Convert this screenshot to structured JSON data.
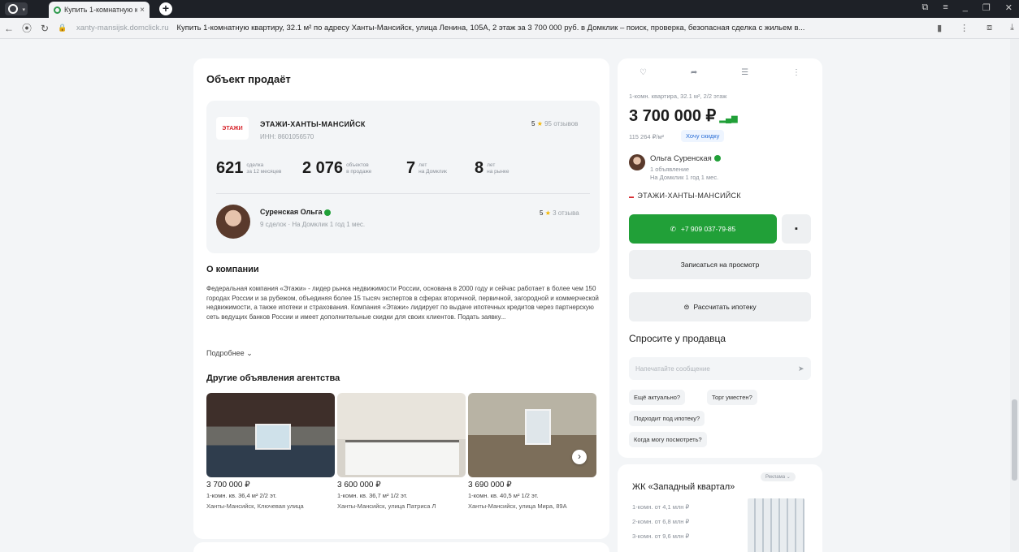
{
  "browser": {
    "tab_title": "Купить 1-комнатную к",
    "url_host": "xanty-mansijsk.domclick.ru",
    "page_title": "Купить 1-комнатную квартиру, 32.1 м² по адресу Ханты-Мансийск, улица Ленина, 105А, 2 этаж за 3 700 000 руб. в Домклик – поиск, проверка, безопасная сделка с жильем в..."
  },
  "seller_section": {
    "title": "Объект продаёт",
    "agency": {
      "logo_text": "ЭТАЖИ",
      "name": "ЭТАЖИ-ХАНТЫ-МАНСИЙСК",
      "inn": "ИНН: 8601056570",
      "rating": "5",
      "reviews": "95 отзывов"
    },
    "stats": [
      {
        "value": "621",
        "label1": "сделка",
        "label2": "за 12 месяцев"
      },
      {
        "value": "2 076",
        "label1": "объектов",
        "label2": "в продаже"
      },
      {
        "value": "7",
        "label1": "лет",
        "label2": "на Домклик"
      },
      {
        "value": "8",
        "label1": "лет",
        "label2": "на рынке"
      }
    ],
    "agent": {
      "name": "Суренская Ольга",
      "meta": "9 сделок · На Домклик 1 год 1 мес.",
      "rating": "5",
      "reviews": "3 отзыва"
    }
  },
  "about": {
    "title": "О компании",
    "text": "Федеральная компания «Этажи» - лидер рынка недвижимости России, основана в 2000 году и сейчас работает в более чем 150 городах России и за рубежом, объединяя более 15 тысяч экспертов в сферах вторичной, первичной, загородной и коммерческой недвижимости, а также ипотеки и страхования. Компания «Этажи» лидирует по выдаче ипотечных кредитов через партнерскую сеть ведущих банков России и имеет дополнительные скидки для своих клиентов. Подать заявку...",
    "more_label": "Подробнее"
  },
  "other_listings": {
    "title": "Другие объявления агентства",
    "items": [
      {
        "price": "3 700 000 ₽",
        "params": "1-комн. кв.  36,4 м²  2/2 эт.",
        "address": "Ханты-Мансийск, Ключевая улица"
      },
      {
        "price": "3 600 000 ₽",
        "params": "1-комн. кв.  36,7 м²  1/2 эт.",
        "address": "Ханты-Мансийск, улица Патриса Л"
      },
      {
        "price": "3 690 000 ₽",
        "params": "1-комн. кв.  40,5 м²  1/2 эт.",
        "address": "Ханты-Мансийск, улица Мира, 89А"
      }
    ]
  },
  "offer": {
    "subtitle": "1-комн. квартира, 32.1 м², 2/2 этаж",
    "price": "3 700 000 ₽",
    "price_per_m": "115 264 ₽/м²",
    "discount_label": "Хочу скидку",
    "agent_name": "Ольга Суренская",
    "agent_listings": "1 объявление",
    "agent_since": "На Домклик 1 год 1 мес.",
    "agency_name": "ЭТАЖИ-ХАНТЫ-МАНСИЙСК",
    "phone": "+7 909 037-79-85",
    "viewing_label": "Записаться на просмотр",
    "mortgage_label": "Рассчитать ипотеку",
    "ask_title": "Спросите у продавца",
    "message_placeholder": "Напечатайте сообщение",
    "quick_questions": [
      "Ещё актуально?",
      "Торг уместен?",
      "Подходит под ипотеку?",
      "Когда могу посмотреть?"
    ]
  },
  "ad": {
    "badge": "Реклама",
    "title": "ЖК «Западный квартал»",
    "lines": [
      "1-комн. от 4,1 млн ₽",
      "2-комн. от 6,8 млн ₽",
      "3-комн. от 9,6 млн ₽"
    ]
  },
  "colors": {
    "accent_green": "#21a038",
    "brand_red": "#d7262d",
    "link_blue": "#2b6fd6"
  }
}
